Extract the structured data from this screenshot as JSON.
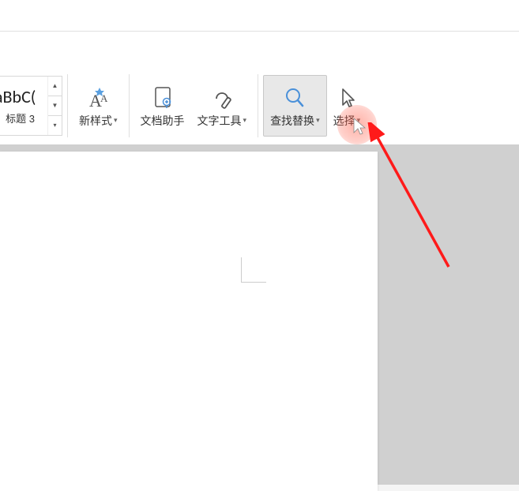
{
  "styleGallery": {
    "items": [
      {
        "preview": "aBbC(",
        "label": "标题 3"
      }
    ]
  },
  "toolbar": {
    "newStyle": {
      "label": "新样式"
    },
    "docAssistant": {
      "label": "文档助手"
    },
    "textTools": {
      "label": "文字工具"
    },
    "findReplace": {
      "label": "查找替换"
    },
    "select": {
      "label": "选择"
    }
  },
  "colors": {
    "highlight": "#ff6450",
    "arrow": "#ff1a1a"
  }
}
